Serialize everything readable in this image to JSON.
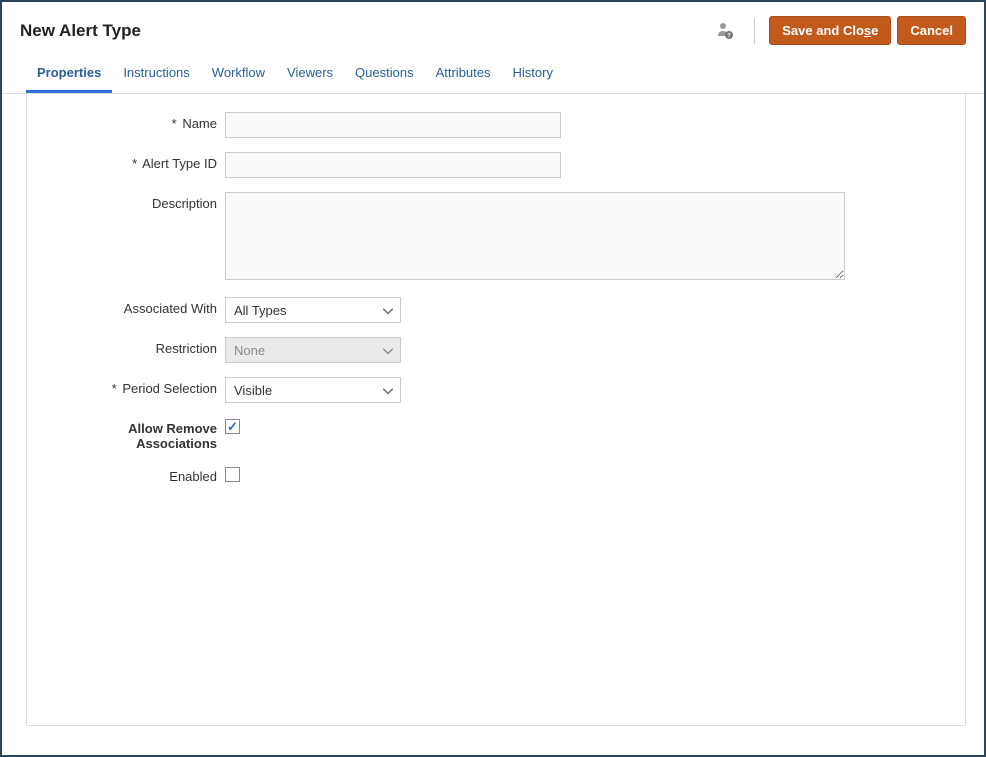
{
  "header": {
    "title": "New Alert Type",
    "save_label_prefix": "Save and Clo",
    "save_label_mnemonic": "s",
    "save_label_suffix": "e",
    "cancel_label": "Cancel"
  },
  "tabs": [
    {
      "label": "Properties",
      "active": true
    },
    {
      "label": "Instructions",
      "active": false
    },
    {
      "label": "Workflow",
      "active": false
    },
    {
      "label": "Viewers",
      "active": false
    },
    {
      "label": "Questions",
      "active": false
    },
    {
      "label": "Attributes",
      "active": false
    },
    {
      "label": "History",
      "active": false
    }
  ],
  "form": {
    "name_label": "Name",
    "name_value": "",
    "alert_type_id_label": "Alert Type ID",
    "alert_type_id_value": "",
    "description_label": "Description",
    "description_value": "",
    "associated_with_label": "Associated With",
    "associated_with_value": "All Types",
    "restriction_label": "Restriction",
    "restriction_value": "None",
    "period_selection_label": "Period Selection",
    "period_selection_value": "Visible",
    "allow_remove_label": "Allow Remove Associations",
    "allow_remove_checked": true,
    "enabled_label": "Enabled",
    "enabled_checked": false
  }
}
